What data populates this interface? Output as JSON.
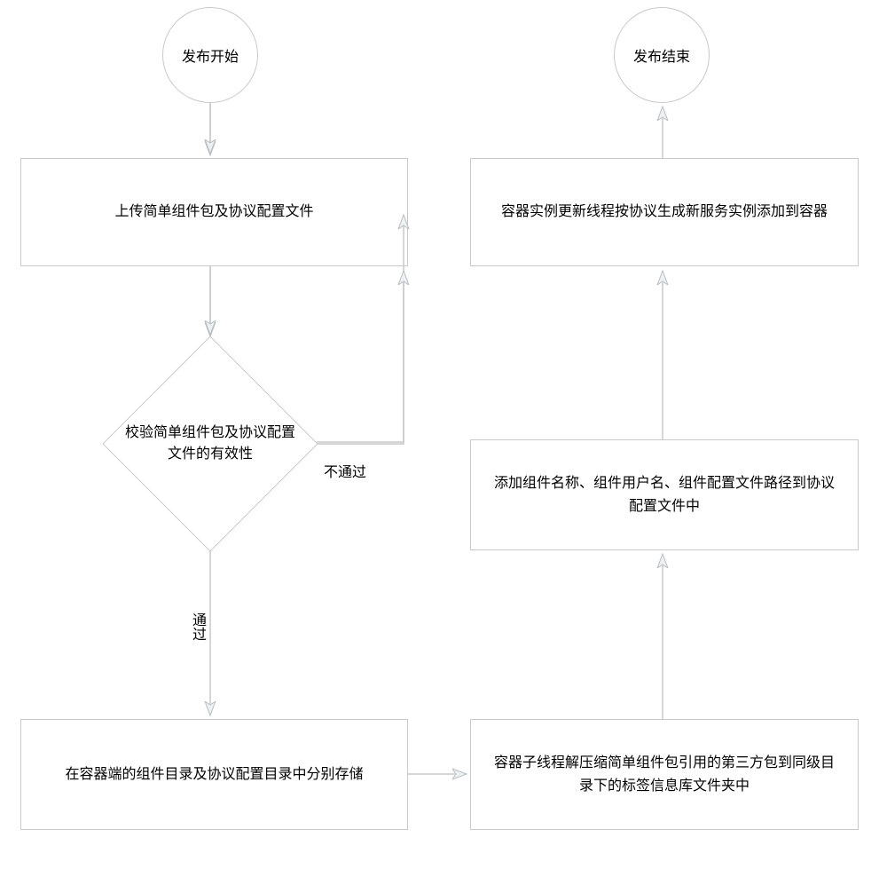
{
  "flow": {
    "start": "发布开始",
    "end": "发布结束",
    "upload": "上传简单组件包及协议配置文件",
    "validate": "校验简单组件包及协议配置文件的有效性",
    "store": "在容器端的组件目录及协议配置目录中分别存储",
    "decompress": "容器子线程解压缩简单组件包引用的第三方包到同级目录下的标签信息库文件夹中",
    "addConfig": "添加组件名称、组件用户名、组件配置文件路径到协议配置文件中",
    "updateInstance": "容器实例更新线程按协议生成新服务实例添加到容器",
    "edges": {
      "fail": "不通过",
      "pass": "通过"
    }
  },
  "colors": {
    "stroke": "#c9c9c9",
    "arrowFill": "#eef1f3",
    "arrowStroke": "#b8bdc0"
  }
}
